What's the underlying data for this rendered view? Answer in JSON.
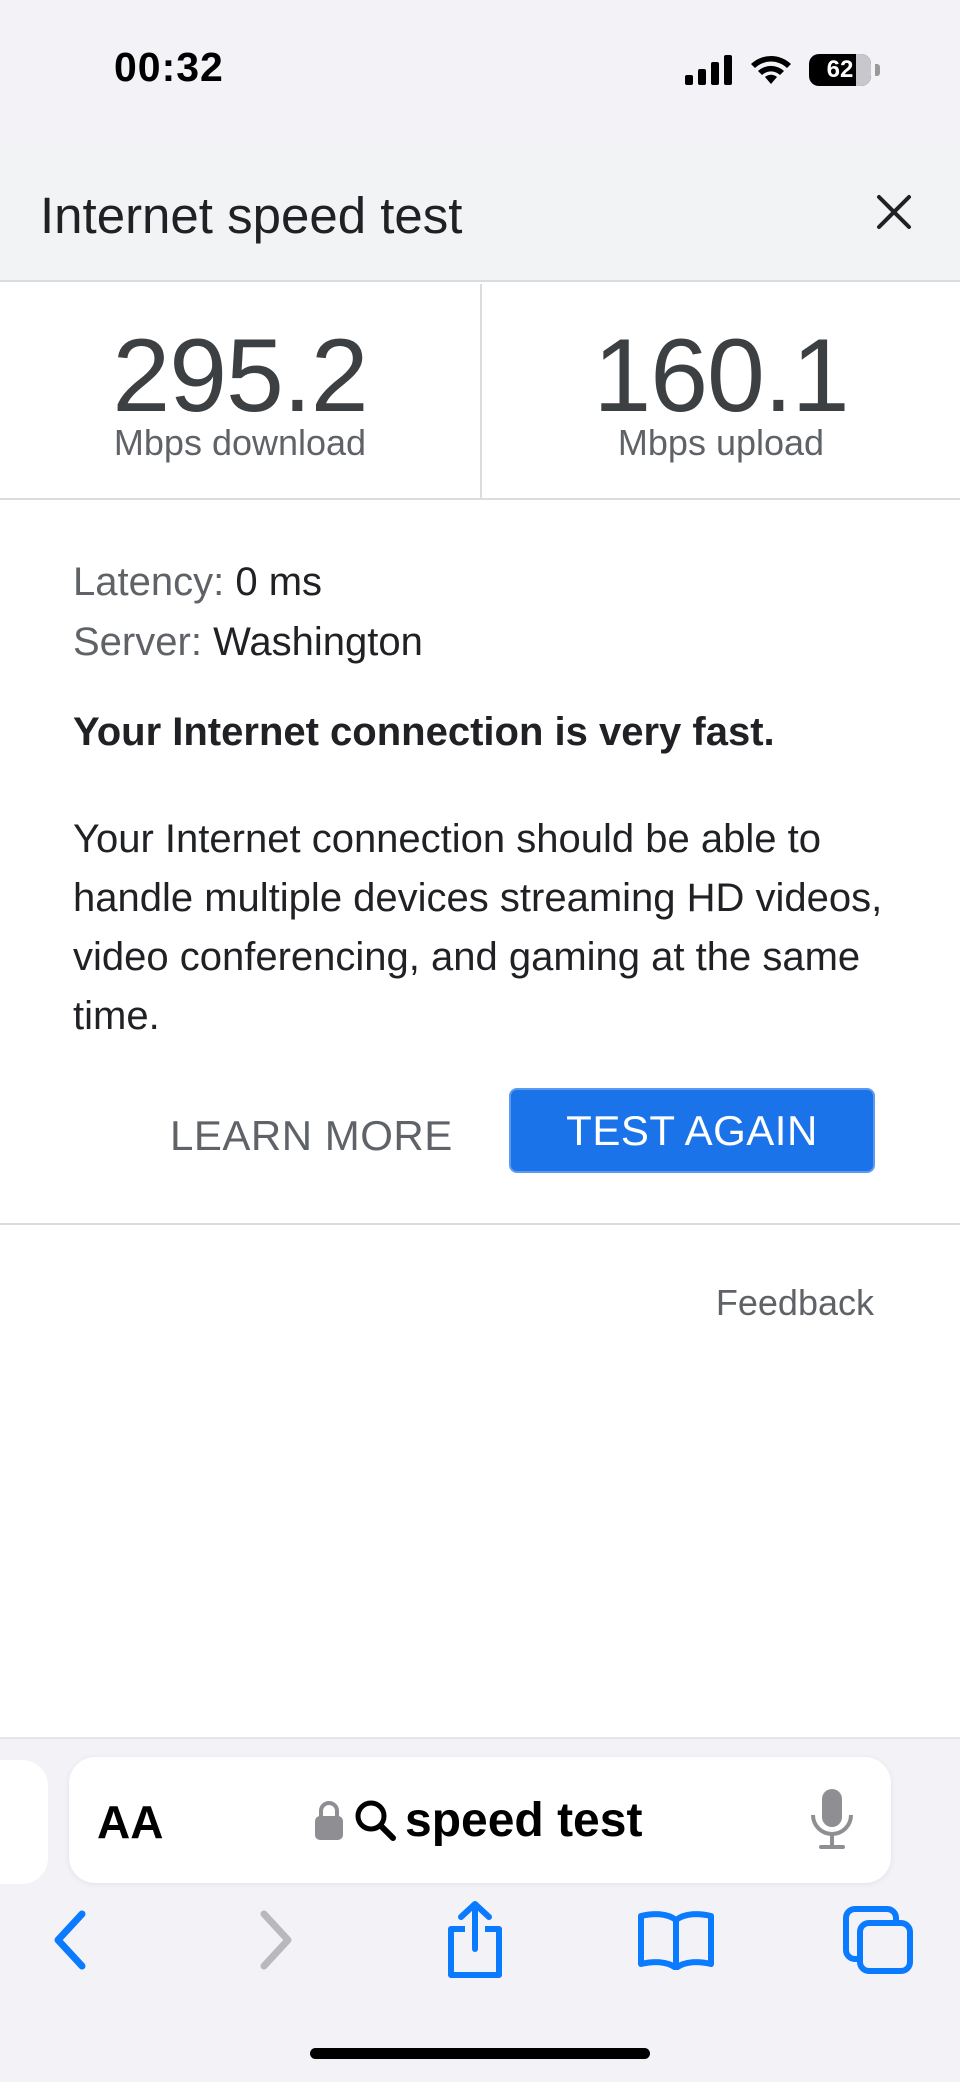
{
  "status_bar": {
    "time": "00:32",
    "battery": "62"
  },
  "card": {
    "title": "Internet speed test",
    "download": {
      "value": "295.2",
      "label": "Mbps download"
    },
    "upload": {
      "value": "160.1",
      "label": "Mbps upload"
    },
    "latency_label": "Latency:",
    "latency_value": "0 ms",
    "server_label": "Server:",
    "server_value": "Washington",
    "verdict": "Your Internet connection is very fast.",
    "explanation": "Your Internet connection should be able to handle multiple devices streaming HD videos, video conferencing, and gaming at the same time.",
    "learn_more": "LEARN MORE",
    "test_again": "TEST AGAIN",
    "feedback": "Feedback"
  },
  "browser": {
    "text_size_label": "AA",
    "address_text": "speed test"
  },
  "colors": {
    "accent": "#1a73e8",
    "ios_blue": "#0a7aff",
    "text_primary": "#202124",
    "text_secondary": "#5f6368",
    "header_bg": "#f1f3f4"
  }
}
